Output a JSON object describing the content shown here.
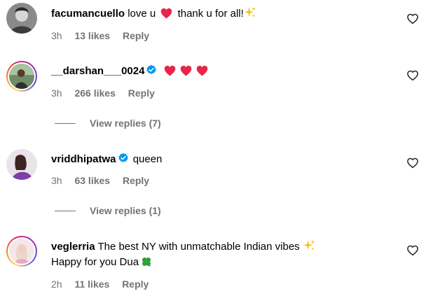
{
  "comments": [
    {
      "username": "facumancuello",
      "text_before": "love u",
      "text_after": "thank u for all!",
      "time": "3h",
      "likes": "13 likes",
      "reply": "Reply",
      "icons": [
        "heart-emoji",
        "sparkles-emoji"
      ]
    },
    {
      "username": "__darshan___0024",
      "verified": true,
      "time": "3h",
      "likes": "266 likes",
      "reply": "Reply",
      "icons": [
        "heart-emoji",
        "heart-emoji",
        "heart-emoji"
      ],
      "view_replies": "View replies (7)"
    },
    {
      "username": "vriddhipatwa",
      "verified": true,
      "text": "queen",
      "time": "3h",
      "likes": "63 likes",
      "reply": "Reply",
      "view_replies": "View replies (1)"
    },
    {
      "username": "veglerria",
      "text_line1": "The best NY with unmatchable Indian vibes",
      "text_line2": "Happy for you Dua",
      "time": "2h",
      "likes": "11 likes",
      "reply": "Reply",
      "icons": [
        "sparkles-emoji",
        "four-leaf-clover-emoji"
      ]
    }
  ],
  "colors": {
    "heart": "#e8264a",
    "verified": "#0095f6",
    "muted_text": "#737373",
    "sparkle": "#f7c325",
    "clover": "#2e9e3c"
  }
}
